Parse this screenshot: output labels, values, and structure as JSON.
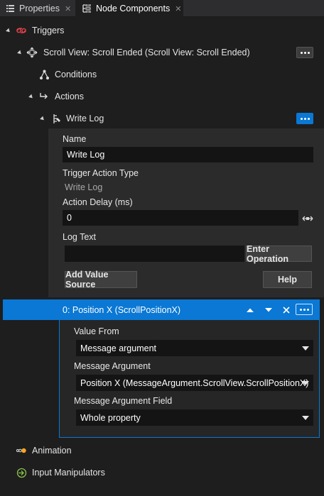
{
  "tabs": [
    {
      "label": "Properties",
      "icon": "list-icon",
      "active": false
    },
    {
      "label": "Node Components",
      "icon": "node-components-icon",
      "active": true
    }
  ],
  "tree": {
    "triggers": {
      "label": "Triggers",
      "icon": "triggers-icon"
    },
    "trigger_item": {
      "label": "Scroll View: Scroll Ended (Scroll View: Scroll Ended)",
      "icon": "scroll-view-icon"
    },
    "conditions": {
      "label": "Conditions",
      "icon": "conditions-icon"
    },
    "actions": {
      "label": "Actions",
      "icon": "actions-icon"
    },
    "write_log": {
      "label": "Write Log",
      "icon": "write-log-icon"
    },
    "animation": {
      "label": "Animation",
      "icon": "animation-icon"
    },
    "input_manipulators": {
      "label": "Input Manipulators",
      "icon": "input-manipulators-icon"
    }
  },
  "properties": {
    "name_label": "Name",
    "name_value": "Write Log",
    "trigger_action_type_label": "Trigger Action Type",
    "trigger_action_type_value": "Write Log",
    "action_delay_label": "Action Delay (ms)",
    "action_delay_value": "0",
    "log_text_label": "Log Text",
    "log_text_value": "",
    "enter_operation_label": "Enter Operation",
    "add_value_source_label": "Add Value Source",
    "help_label": "Help"
  },
  "value_source": {
    "header": "0: Position X (ScrollPositionX)",
    "value_from_label": "Value From",
    "value_from_selected": "Message argument",
    "message_argument_label": "Message Argument",
    "message_argument_selected": "Position X (MessageArgument.ScrollView.ScrollPositionX)",
    "message_argument_field_label": "Message Argument Field",
    "message_argument_field_selected": "Whole property"
  },
  "colors": {
    "accent": "#0a78d4",
    "panel_bg": "#1e1e1e",
    "field_bg": "#141414"
  }
}
